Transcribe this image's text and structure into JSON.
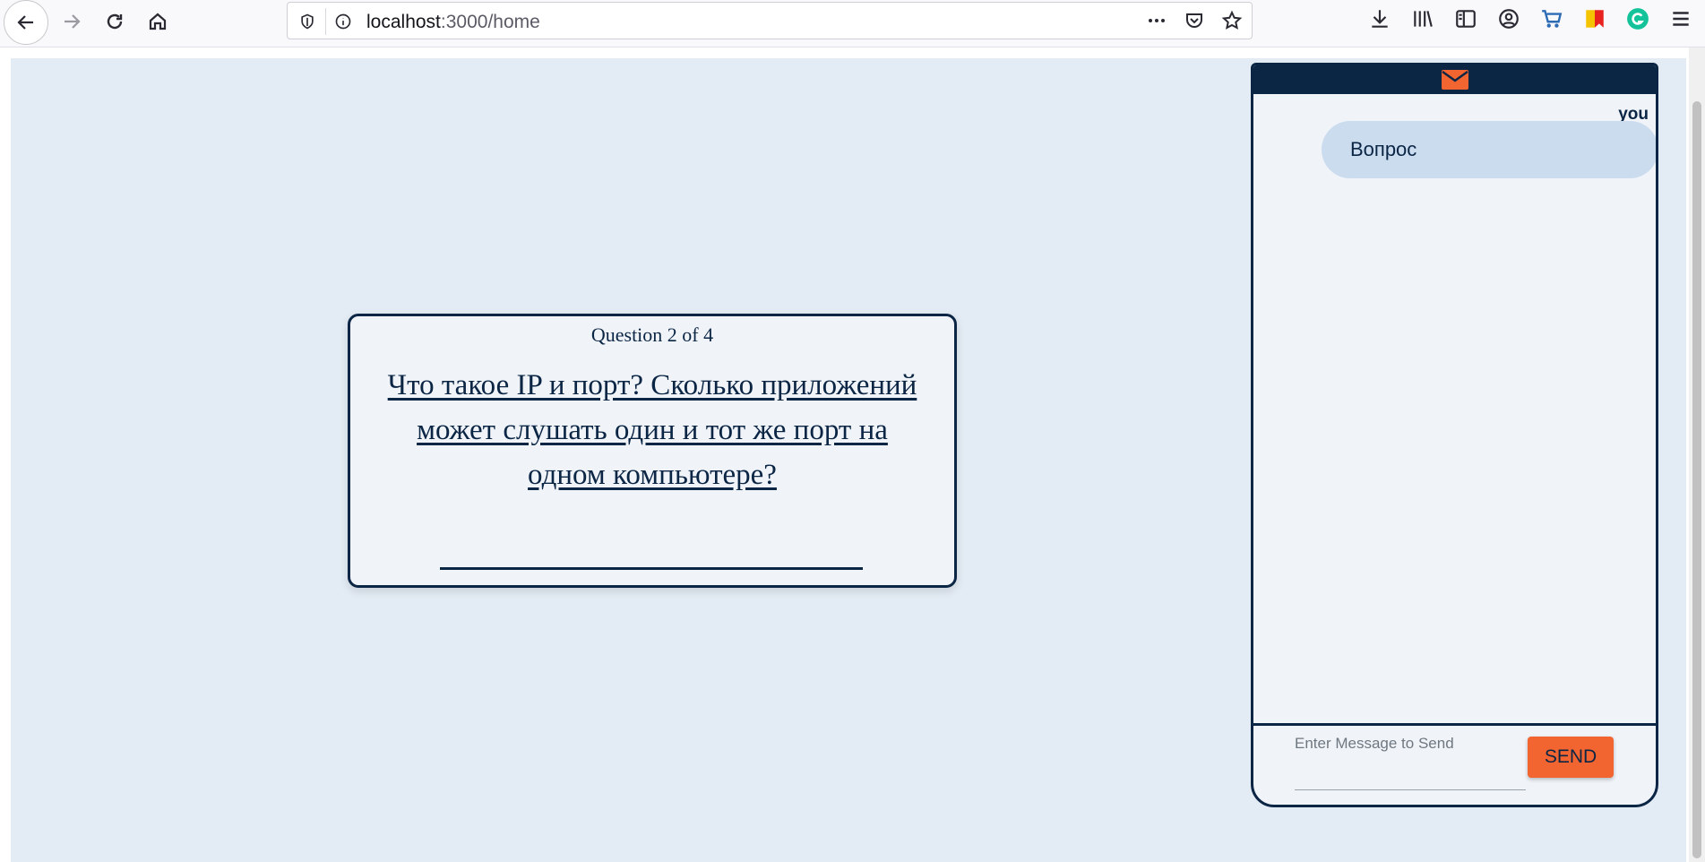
{
  "browser": {
    "url_host": "localhost",
    "url_path": ":3000/home",
    "icons": [
      "back-icon",
      "forward-icon",
      "reload-icon",
      "home-icon",
      "shield-icon",
      "info-icon",
      "more-icon",
      "pocket-icon",
      "bookmark-star-icon",
      "download-icon",
      "library-icon",
      "sidebar-icon",
      "account-icon",
      "cart-icon",
      "bookmark-flag-icon",
      "grammarly-icon",
      "menu-icon"
    ]
  },
  "question": {
    "counter": "Question 2 of 4",
    "text": "Что такое IP и порт? Сколько приложений может слушать один и тот же порт на одном компьютере?"
  },
  "chat": {
    "header_icon": "mail-icon",
    "messages": [
      {
        "author": "you",
        "text": "Вопрос"
      }
    ],
    "input_placeholder": "Enter Message to Send",
    "send_label": "SEND"
  },
  "colors": {
    "navy": "#0b2545",
    "page_bg": "#e3ebf4",
    "card_bg": "#f0f4f9",
    "bubble": "#cbdcef",
    "accent": "#f26430"
  }
}
